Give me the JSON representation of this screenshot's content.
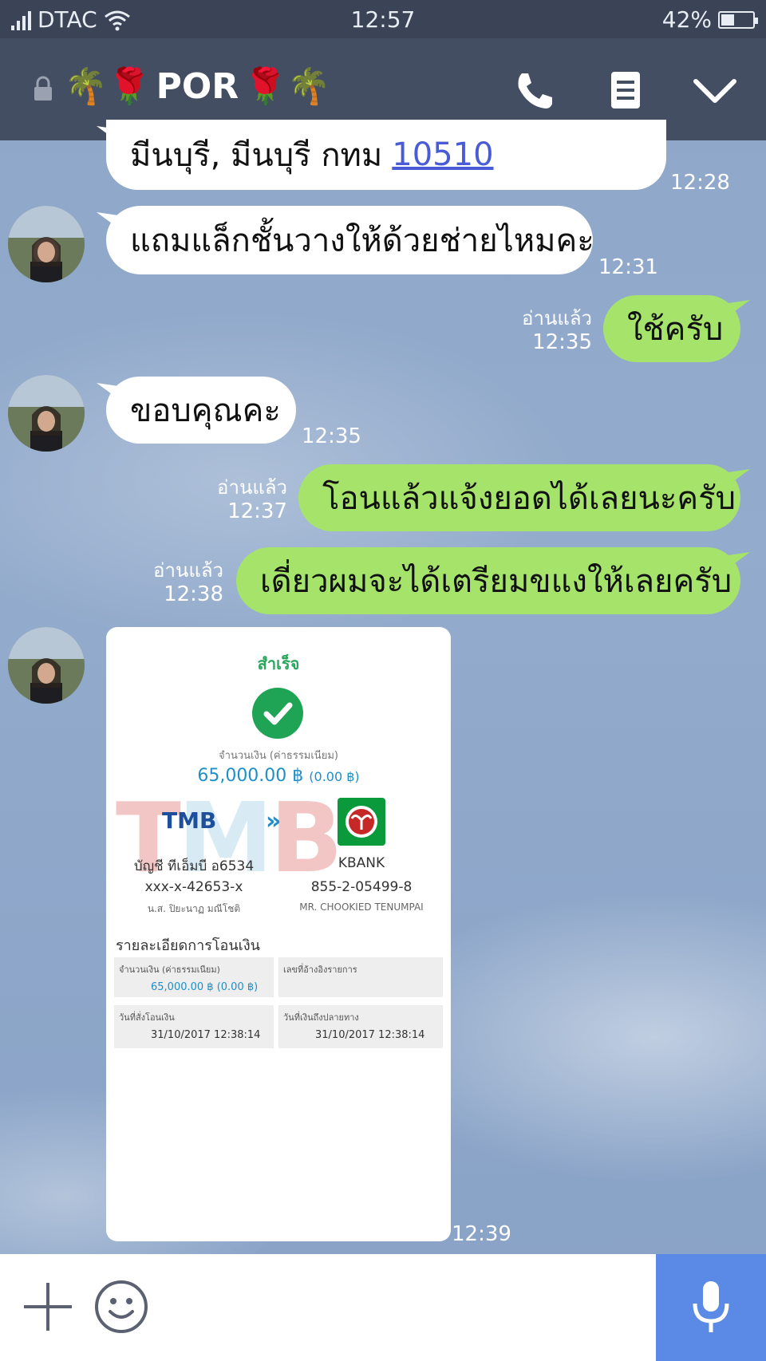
{
  "status_bar": {
    "carrier": "DTAC",
    "time": "12:57",
    "battery": "42%",
    "battery_level": 0.42
  },
  "header": {
    "emoji_left": "🌴🌹",
    "title": "POR",
    "emoji_right": "🌹🌴",
    "icons": [
      "lock-icon",
      "phone-icon",
      "notes-icon",
      "chevron-down-icon"
    ]
  },
  "messages": {
    "m1": {
      "text": "มีนบุรี, มีนบุรี กทม",
      "link": "10510",
      "time": "12:28"
    },
    "m2": {
      "text": "แถมแล็กชั้นวางให้ด้วยช่ายไหมคะ",
      "time": "12:31"
    },
    "m3": {
      "text": "ใช้ครับ",
      "read": "อ่านแล้ว",
      "time": "12:35"
    },
    "m4": {
      "text": "ขอบคุณคะ",
      "time": "12:35"
    },
    "m5": {
      "text": "โอนแล้วแจ้งยอดได้เลยนะครับ",
      "read": "อ่านแล้ว",
      "time": "12:37"
    },
    "m6": {
      "text": "เดี่ยวผมจะได้เตรียมขแงให้เลยครับ",
      "read": "อ่านแล้ว",
      "time": "12:38"
    },
    "m7": {
      "time": "12:39"
    }
  },
  "slip": {
    "status": "สำเร็จ",
    "amount_label": "จำนวนเงิน (ค่าธรรมเนียม)",
    "amount": "65,000.00 ฿",
    "fee": "(0.00 ฿)",
    "from_bank": "TMB",
    "to_bank": "KBANK",
    "from_account_name": "บัญชี ทีเอ็มบี อ6534",
    "from_account_no": "xxx-x-42653-x",
    "from_owner": "น.ส. ปิยะนาฏ มณีโชติ",
    "to_account_no": "855-2-05499-8",
    "to_owner": "MR. CHOOKIED TENUMPAI",
    "details_title": "รายละเอียดการโอนเงิน",
    "cell_amount_label": "จำนวนเงิน (ค่าธรรมเนียม)",
    "cell_amount_value": "65,000.00 ฿ (0.00 ฿)",
    "cell_ref_label": "เลขที่อ้างอิงรายการ",
    "cell_date_label": "วันที่สั่งโอนเงิน",
    "cell_date_value": "31/10/2017 12:38:14",
    "cell_arrive_label": "วันที่เงินถึงปลายทาง",
    "cell_arrive_value": "31/10/2017 12:38:14"
  },
  "input_bar": {
    "icons": [
      "plus-icon",
      "emoji-icon",
      "microphone-icon"
    ]
  }
}
